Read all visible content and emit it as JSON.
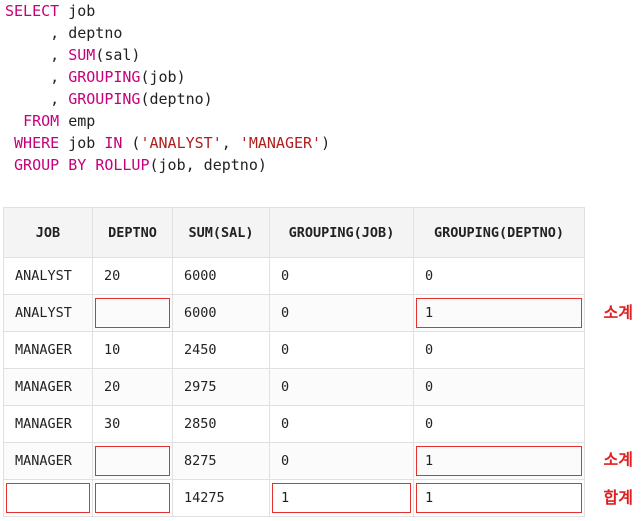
{
  "code": {
    "line1": {
      "kw": "SELECT",
      "rest": " job"
    },
    "line2": {
      "pre": "     , ",
      "rest": "deptno"
    },
    "line3": {
      "pre": "     , ",
      "fn": "SUM",
      "rest": "(sal)"
    },
    "line4": {
      "pre": "     , ",
      "fn": "GROUPING",
      "rest": "(job)"
    },
    "line5": {
      "pre": "     , ",
      "fn": "GROUPING",
      "rest": "(deptno)"
    },
    "line6": {
      "pre": "  ",
      "kw": "FROM",
      "rest": " emp"
    },
    "line7": {
      "pre": " ",
      "kw": "WHERE",
      "mid": " job ",
      "kw2": "IN",
      "open": " (",
      "s1": "'ANALYST'",
      "comma": ", ",
      "s2": "'MANAGER'",
      "close": ")"
    },
    "line8": {
      "pre": " ",
      "kw": "GROUP",
      "sp": " ",
      "kw2": "BY",
      "sp2": " ",
      "fn": "ROLLUP",
      "rest": "(job, deptno)"
    }
  },
  "table": {
    "headers": [
      "JOB",
      "DEPTNO",
      "SUM(SAL)",
      "GROUPING(JOB)",
      "GROUPING(DEPTNO)"
    ],
    "rows": [
      [
        "ANALYST",
        "20",
        "6000",
        "0",
        "0"
      ],
      [
        "ANALYST",
        "",
        "6000",
        "0",
        "1"
      ],
      [
        "MANAGER",
        "10",
        "2450",
        "0",
        "0"
      ],
      [
        "MANAGER",
        "20",
        "2975",
        "0",
        "0"
      ],
      [
        "MANAGER",
        "30",
        "2850",
        "0",
        "0"
      ],
      [
        "MANAGER",
        "",
        "8275",
        "0",
        "1"
      ],
      [
        "",
        "",
        "14275",
        "1",
        "1"
      ]
    ]
  },
  "notes": {
    "subtotal1": "소계",
    "subtotal2": "소계",
    "total": "합계"
  },
  "colors": {
    "keyword": "#c6007a",
    "string": "#b01e1e",
    "highlight": "#e53030",
    "note": "#e02020"
  }
}
